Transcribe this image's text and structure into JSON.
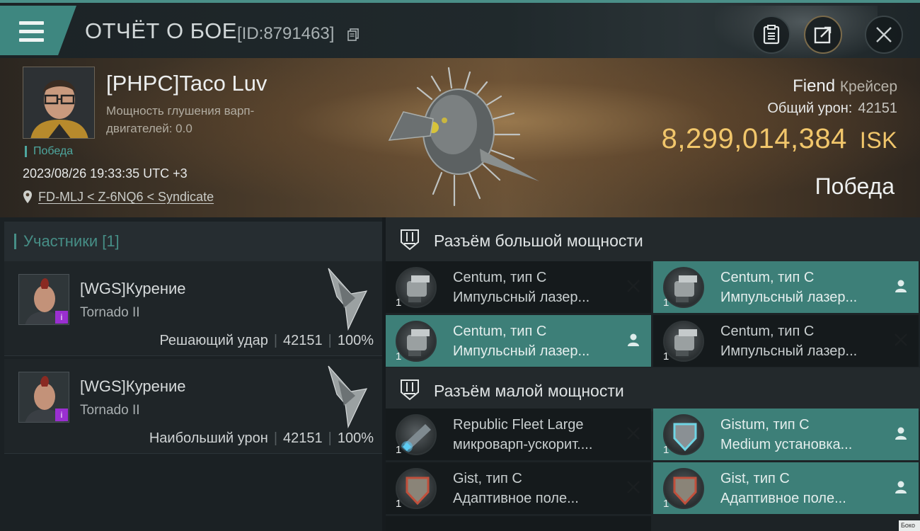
{
  "header": {
    "title": "ОТЧЁТ О БОЕ",
    "report_id": "[ID:8791463]",
    "icons": [
      "menu-icon",
      "copy-icon",
      "clipboard-icon",
      "share-icon",
      "close-icon"
    ]
  },
  "victim": {
    "pilot_name": "[PHPC]Taco Luv",
    "warp_label": "Мощность глушения варп-двигателей: 0.0",
    "result_tag": "Победа",
    "datetime": "2023/08/26 19:33:35 UTC +3",
    "location": "FD-MLJ < Z-6NQ6 < Syndicate",
    "ship_name": "Fiend",
    "ship_class": "Крейсер",
    "total_damage_label": "Общий урон:",
    "total_damage": "42151",
    "isk_value": "8,299,014,384",
    "isk_unit": "ISK",
    "result": "Победа"
  },
  "participants": {
    "header": "Участники [1]",
    "items": [
      {
        "name": "[WGS]Курение",
        "ship": "Tornado II",
        "role": "Решающий удар",
        "damage": "42151",
        "percent": "100%",
        "badge": "i"
      },
      {
        "name": "[WGS]Курение",
        "ship": "Tornado II",
        "role": "Наибольший урон",
        "damage": "42151",
        "percent": "100%",
        "badge": "i"
      }
    ]
  },
  "high_slots": {
    "title": "Разъём большой мощности",
    "items": [
      {
        "qty": "1",
        "name": "Centum, тип C",
        "type": "Импульсный лазер...",
        "status": "destroyed"
      },
      {
        "qty": "1",
        "name": "Centum, тип C",
        "type": "Импульсный лазер...",
        "status": "dropped"
      },
      {
        "qty": "1",
        "name": "Centum, тип C",
        "type": "Импульсный лазер...",
        "status": "dropped"
      },
      {
        "qty": "1",
        "name": "Centum, тип C",
        "type": "Импульсный лазер...",
        "status": "destroyed"
      }
    ]
  },
  "low_slots": {
    "title": "Разъём малой мощности",
    "items": [
      {
        "qty": "1",
        "name": "Republic Fleet Large",
        "type": "микроварп-ускорит....",
        "status": "destroyed"
      },
      {
        "qty": "1",
        "name": "Gistum, тип C",
        "type": "Medium установка...",
        "status": "dropped"
      },
      {
        "qty": "1",
        "name": "Gist, тип C",
        "type": "Адаптивное поле...",
        "status": "destroyed"
      },
      {
        "qty": "1",
        "name": "Gist, тип C",
        "type": "Адаптивное поле...",
        "status": "dropped"
      }
    ]
  },
  "edge_tab": "Боко",
  "colors": {
    "accent": "#3d7f78",
    "isk": "#f1c66b",
    "badge": "#9a2fd0"
  }
}
